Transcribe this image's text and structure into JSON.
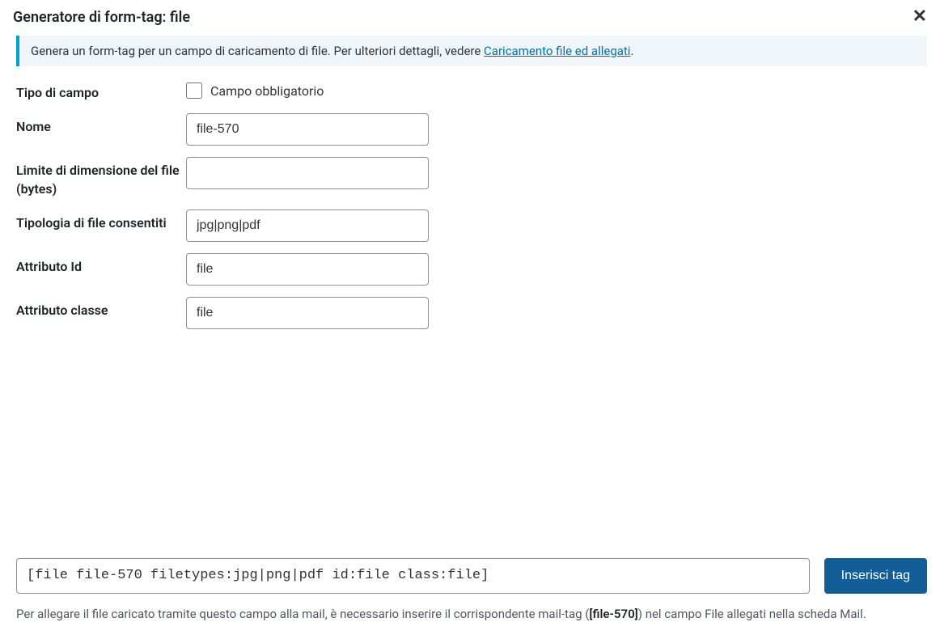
{
  "header": {
    "title": "Generatore di form-tag: file"
  },
  "info": {
    "text_prefix": "Genera un form-tag per un campo di caricamento di file. Per ulteriori dettagli, vedere ",
    "link_text": "Caricamento file ed allegati",
    "text_suffix": "."
  },
  "fields": {
    "type_label": "Tipo di campo",
    "required_label": "Campo obbligatorio",
    "name_label": "Nome",
    "name_value": "file-570",
    "limit_label": "Limite di dimensione del file (bytes)",
    "limit_value": "",
    "filetypes_label": "Tipologia di file consentiti",
    "filetypes_value": "jpg|png|pdf",
    "id_label": "Attributo Id",
    "id_value": "file",
    "class_label": "Attributo classe",
    "class_value": "file"
  },
  "footer": {
    "tag_value": "[file file-570 filetypes:jpg|png|pdf id:file class:file]",
    "insert_label": "Inserisci tag",
    "note_prefix": "Per allegare il file caricato tramite questo campo alla mail, è necessario inserire il corrispondente mail-tag (",
    "note_strong": "[file-570]",
    "note_suffix": ") nel campo File allegati nella scheda Mail."
  }
}
